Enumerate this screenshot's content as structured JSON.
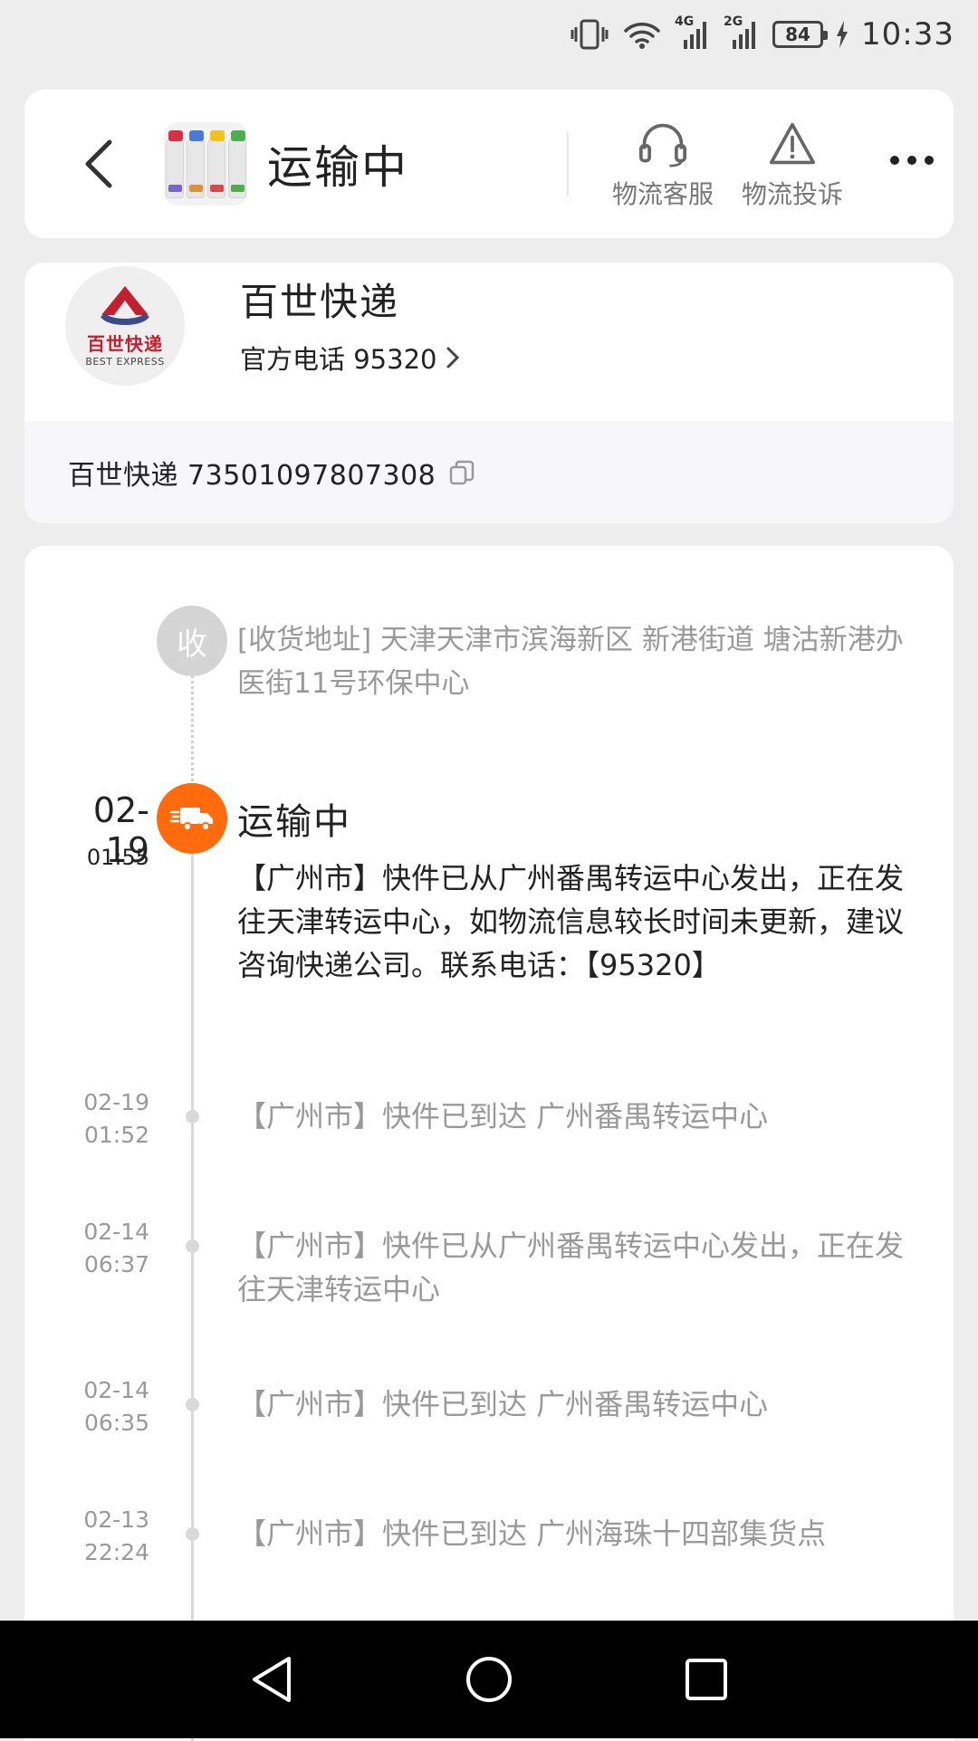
{
  "status_bar": {
    "network_4g": "4G",
    "network_2g": "2G",
    "battery": "84",
    "time": "10:33"
  },
  "header": {
    "title": "运输中",
    "customer_service_label": "物流客服",
    "complaint_label": "物流投诉"
  },
  "courier": {
    "logo_cn": "百世快递",
    "logo_en": "BEST EXPRESS",
    "name": "百世快递",
    "phone_label": "官方电话 95320",
    "tracking": "百世快递 73501097807308"
  },
  "timeline": {
    "receive_badge": "收",
    "receive_address": "[收货地址] 天津天津市滨海新区 新港街道   塘沽新港办医街11号环保中心",
    "current": {
      "date": "02-19",
      "time": "01:55",
      "status": "运输中",
      "description": "【广州市】快件已从广州番禺转运中心发出，正在发往天津转运中心，如物流信息较长时间未更新，建议咨询快递公司。联系电话：【95320】"
    },
    "events": [
      {
        "date": "02-19",
        "time": "01:52",
        "description": "【广州市】快件已到达 广州番禺转运中心"
      },
      {
        "date": "02-14",
        "time": "06:37",
        "description": "【广州市】快件已从广州番禺转运中心发出，正在发往天津转运中心"
      },
      {
        "date": "02-14",
        "time": "06:35",
        "description": "【广州市】快件已到达 广州番禺转运中心"
      },
      {
        "date": "02-13",
        "time": "22:24",
        "description": "【广州市】快件已到达 广州海珠十四部集货点"
      }
    ]
  },
  "colors": {
    "accent_orange": "#ff6b0d",
    "logo_red": "#c21f2f",
    "background": "#ededed"
  },
  "icons": {
    "back": "chevron-left-icon",
    "customer_service": "headset-icon",
    "complaint": "warning-triangle-icon",
    "more": "more-dots-icon",
    "copy": "copy-icon",
    "truck": "truck-icon"
  }
}
